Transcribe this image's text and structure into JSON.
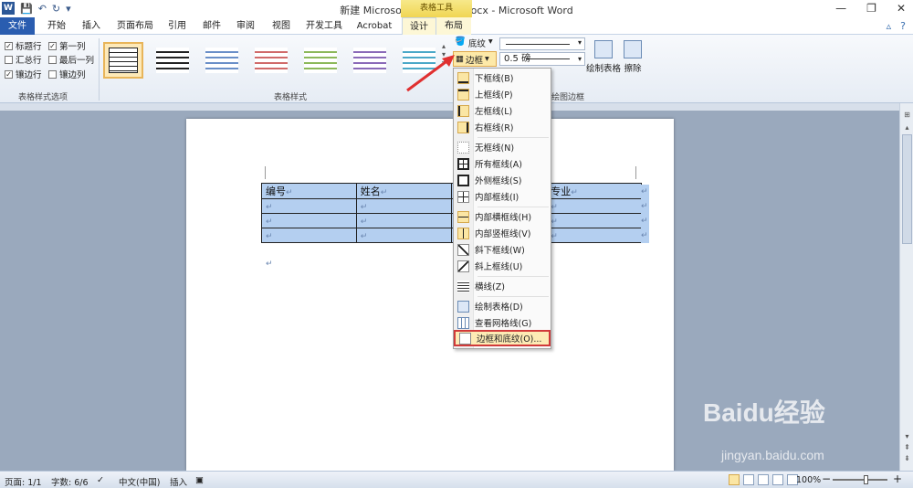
{
  "window": {
    "title": "新建 Microsoft Word 文档.docx - Microsoft Word",
    "context_tab_group": "表格工具",
    "app_icon": "word-logo-icon"
  },
  "tabs": [
    "文件",
    "开始",
    "插入",
    "页面布局",
    "引用",
    "邮件",
    "审阅",
    "视图",
    "开发工具",
    "Acrobat",
    "设计",
    "布局"
  ],
  "active_tab": "设计",
  "ribbon": {
    "style_options": {
      "label": "表格样式选项",
      "items": [
        {
          "label": "标题行",
          "checked": true
        },
        {
          "label": "第一列",
          "checked": true
        },
        {
          "label": "汇总行",
          "checked": false
        },
        {
          "label": "最后一列",
          "checked": false
        },
        {
          "label": "镶边行",
          "checked": true
        },
        {
          "label": "镶边列",
          "checked": false
        }
      ]
    },
    "styles_label": "表格样式",
    "shading_label": "底纹",
    "borders_label": "边框",
    "line_weight": "0.5 磅",
    "draw_table_label": "绘制表格",
    "eraser_label": "擦除",
    "draw_borders_label": "绘图边框",
    "style_colors": [
      "#222222",
      "#555555",
      "#6a8fc8",
      "#d06a6a",
      "#8cb85a",
      "#8a6ab8",
      "#4aa8c8"
    ]
  },
  "document": {
    "table": {
      "headers": [
        "编号",
        "姓名",
        "",
        "专业"
      ],
      "row_count": 3
    },
    "cell_mark": "↵"
  },
  "borders_menu": {
    "items": [
      {
        "label": "下框线(B)",
        "icon": "bottom-border-icon",
        "highlighted": true
      },
      {
        "label": "上框线(P)",
        "icon": "top-border-icon",
        "highlighted": true
      },
      {
        "label": "左框线(L)",
        "icon": "left-border-icon",
        "highlighted": true
      },
      {
        "label": "右框线(R)",
        "icon": "right-border-icon",
        "highlighted": true
      },
      {
        "label": "无框线(N)",
        "icon": "no-border-icon",
        "highlighted": false
      },
      {
        "label": "所有框线(A)",
        "icon": "all-borders-icon",
        "highlighted": false
      },
      {
        "label": "外侧框线(S)",
        "icon": "outside-borders-icon",
        "highlighted": false
      },
      {
        "label": "内部框线(I)",
        "icon": "inside-borders-icon",
        "highlighted": false
      },
      {
        "label": "内部横框线(H)",
        "icon": "inside-horizontal-border-icon",
        "highlighted": true
      },
      {
        "label": "内部竖框线(V)",
        "icon": "inside-vertical-border-icon",
        "highlighted": true
      },
      {
        "label": "斜下框线(W)",
        "icon": "diagonal-down-border-icon",
        "highlighted": false
      },
      {
        "label": "斜上框线(U)",
        "icon": "diagonal-up-border-icon",
        "highlighted": false
      },
      {
        "label": "横线(Z)",
        "icon": "horizontal-line-icon",
        "highlighted": false
      },
      {
        "label": "绘制表格(D)",
        "icon": "draw-table-icon",
        "highlighted": false
      },
      {
        "label": "查看网格线(G)",
        "icon": "view-gridlines-icon",
        "highlighted": false
      },
      {
        "label": "边框和底纹(O)...",
        "icon": "borders-shading-icon",
        "highlighted": false,
        "selected": true
      }
    ]
  },
  "status_bar": {
    "page": "页面: 1/1",
    "words": "字数: 6/6",
    "language": "中文(中国)",
    "mode": "插入",
    "zoom": "100%"
  },
  "watermark": {
    "brand": "Baidu经验",
    "url": "jingyan.baidu.com"
  },
  "colors": {
    "file_tab": "#2a5db0",
    "table_shading": "#b4cff0",
    "highlight_box": "#d13a3a",
    "arrow": "#e03030"
  }
}
